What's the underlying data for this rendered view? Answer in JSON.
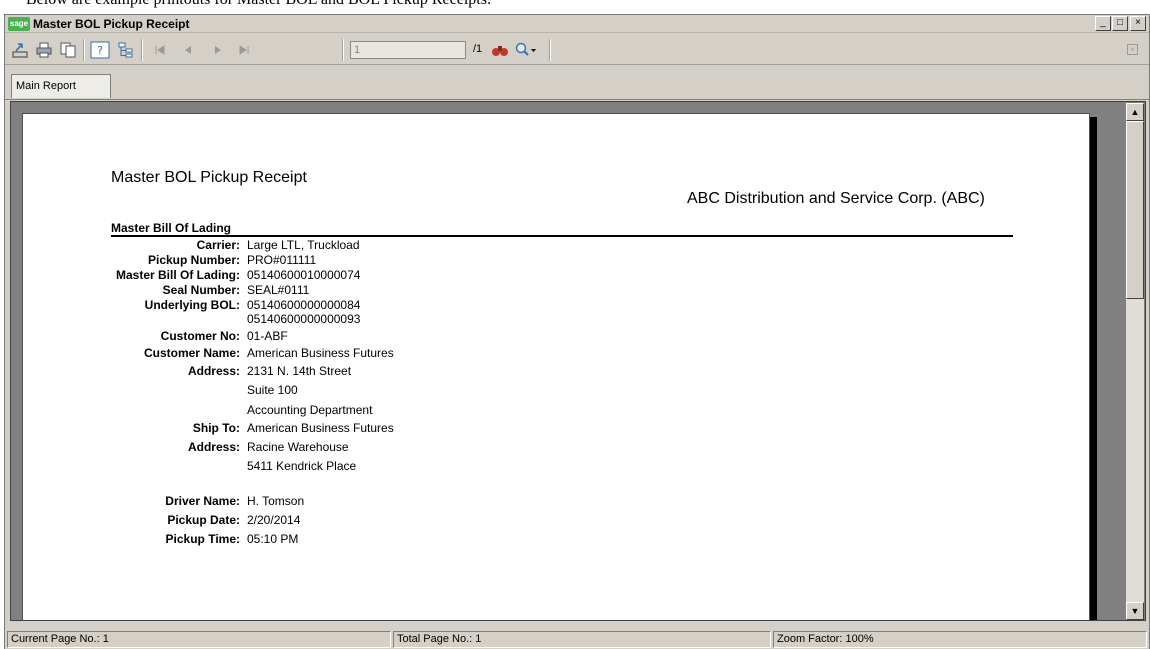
{
  "document_caption": "Below are example printouts for Master BOL and BOL Pickup Receipts:",
  "window": {
    "badge": "sage",
    "title": "Master BOL Pickup Receipt",
    "controls": {
      "minimize": "_",
      "maximize": "□",
      "close": "×"
    }
  },
  "toolbar": {
    "page_value": "1",
    "page_total": "/1"
  },
  "tabs": [
    {
      "label": "Main Report"
    }
  ],
  "report": {
    "title": "Master BOL Pickup Receipt",
    "company": "ABC Distribution and Service Corp. (ABC)",
    "section_heading": "Master Bill Of Lading",
    "fields": [
      {
        "label": "Carrier:",
        "value": "Large LTL, Truckload"
      },
      {
        "label": "Pickup Number:",
        "value": "PRO#011111"
      },
      {
        "label": "Master Bill Of Lading:",
        "value": "05140600010000074"
      },
      {
        "label": "Seal Number:",
        "value": "SEAL#0111"
      },
      {
        "label": "Underlying BOL:",
        "value": "05140600000000084"
      },
      {
        "label": "",
        "value": "05140600000000093"
      },
      {
        "label": "Customer No:",
        "value": "01-ABF"
      },
      {
        "label": "Customer Name:",
        "value": "American Business Futures"
      },
      {
        "label": "Address:",
        "value": "2131 N. 14th Street"
      },
      {
        "label": "",
        "value": "Suite 100"
      },
      {
        "label": "",
        "value": "Accounting Department"
      },
      {
        "label": "Ship To:",
        "value": "American Business Futures"
      },
      {
        "label": "Address:",
        "value": "Racine Warehouse"
      },
      {
        "label": "",
        "value": "5411 Kendrick Place"
      },
      {
        "label": "Driver Name:",
        "value": "H. Tomson"
      },
      {
        "label": "Pickup Date:",
        "value": "2/20/2014"
      },
      {
        "label": "Pickup Time:",
        "value": "05:10 PM"
      }
    ]
  },
  "statusbar": {
    "current_page": "Current Page No.: 1",
    "total_page": "Total Page No.: 1",
    "zoom": "Zoom Factor: 100%"
  },
  "colors": {
    "chrome": "#d4d0c8",
    "viewport": "#808080",
    "badge": "#4caf50"
  }
}
